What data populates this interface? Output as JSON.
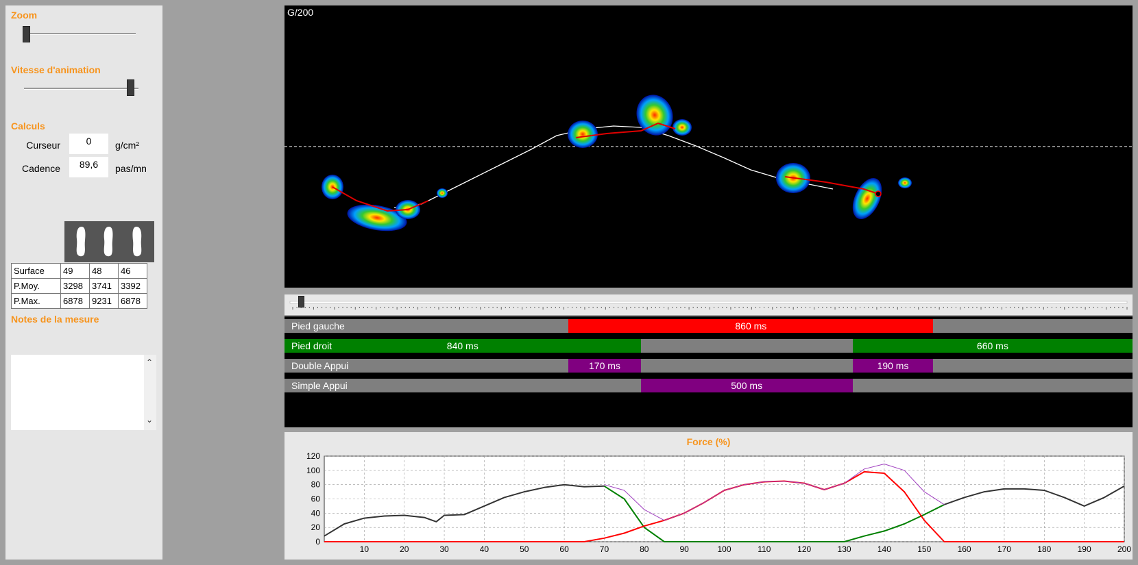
{
  "left": {
    "zoom_title": "Zoom",
    "zoom_level": 0.0,
    "speed_title": "Vitesse d'animation",
    "speed_level": 1.0,
    "calc_title": "Calculs",
    "cursor_label": "Curseur",
    "cursor_value": "0",
    "cursor_unit": "g/cm²",
    "cadence_label": "Cadence",
    "cadence_value": "89,6",
    "cadence_unit": "pas/mn",
    "feet_icons": [
      "left-foot-icon",
      "both-feet-icon",
      "right-foot-icon"
    ],
    "stats": [
      {
        "label": "Surface",
        "values": [
          "49",
          "48",
          "46"
        ]
      },
      {
        "label": "P.Moy.",
        "values": [
          "3298",
          "3741",
          "3392"
        ]
      },
      {
        "label": "P.Max.",
        "values": [
          "6878",
          "9231",
          "6878"
        ]
      }
    ],
    "notes_title": "Notes de la mesure",
    "notes_text": ""
  },
  "canvas": {
    "label": "G/200",
    "playhead_position": 0.01
  },
  "phases": [
    {
      "label": "Pied gauche",
      "segments": [
        {
          "start": 0.335,
          "end": 0.765,
          "color": "#ff0000",
          "text": "860 ms"
        }
      ]
    },
    {
      "label": "Pied droit",
      "segments": [
        {
          "start": 0.0,
          "end": 0.42,
          "color": "#008000",
          "text": "840 ms"
        },
        {
          "start": 0.67,
          "end": 1.0,
          "color": "#008000",
          "text": "660 ms"
        }
      ]
    },
    {
      "label": "Double Appui",
      "segments": [
        {
          "start": 0.335,
          "end": 0.42,
          "color": "#800080",
          "text": "170 ms"
        },
        {
          "start": 0.67,
          "end": 0.765,
          "color": "#800080",
          "text": "190 ms"
        }
      ]
    },
    {
      "label": "Simple Appui",
      "segments": [
        {
          "start": 0.42,
          "end": 0.67,
          "color": "#800080",
          "text": "500 ms"
        }
      ]
    }
  ],
  "chart_data": {
    "type": "line",
    "title": "Force (%)",
    "xlabel": "",
    "ylabel": "",
    "xlim": [
      0,
      200
    ],
    "ylim": [
      0,
      120
    ],
    "xticks": [
      10,
      20,
      30,
      40,
      50,
      60,
      70,
      80,
      90,
      100,
      110,
      120,
      130,
      140,
      150,
      160,
      170,
      180,
      190,
      200
    ],
    "yticks": [
      0,
      20,
      40,
      60,
      80,
      100,
      120
    ],
    "grid": true,
    "series": [
      {
        "color": "#333333",
        "x": [
          0,
          5,
          10,
          15,
          20,
          25,
          28,
          30,
          35,
          40,
          45,
          50,
          55,
          60,
          65,
          70,
          75,
          80,
          85,
          90,
          95,
          100,
          105,
          110,
          115,
          120,
          125,
          130,
          135,
          140,
          145,
          150,
          155,
          160,
          165,
          170,
          175,
          180,
          185,
          190,
          195,
          200
        ],
        "y": [
          8,
          25,
          33,
          36,
          37,
          34,
          28,
          37,
          38,
          50,
          62,
          70,
          76,
          80,
          77,
          78,
          null,
          null,
          null,
          null,
          null,
          null,
          null,
          null,
          null,
          null,
          null,
          null,
          null,
          null,
          null,
          null,
          52,
          62,
          70,
          74,
          74,
          72,
          62,
          50,
          62,
          78
        ]
      },
      {
        "color": "#008000",
        "x": [
          0,
          5,
          10,
          15,
          20,
          25,
          28,
          30,
          35,
          40,
          45,
          50,
          55,
          60,
          65,
          70,
          75,
          80,
          85,
          90,
          95,
          100,
          105,
          110,
          115,
          120,
          125,
          130,
          135,
          140,
          145,
          150,
          155,
          160,
          165,
          170,
          175,
          180,
          185,
          190,
          195,
          200
        ],
        "y": [
          null,
          null,
          null,
          null,
          null,
          null,
          null,
          null,
          null,
          null,
          null,
          null,
          null,
          null,
          null,
          78,
          60,
          20,
          0,
          0,
          0,
          0,
          0,
          0,
          0,
          0,
          0,
          0,
          8,
          15,
          25,
          38,
          52,
          null,
          null,
          null,
          null,
          null,
          null,
          null,
          null,
          null
        ]
      },
      {
        "color": "#ff0000",
        "x": [
          0,
          5,
          10,
          15,
          20,
          25,
          28,
          30,
          35,
          40,
          45,
          50,
          55,
          60,
          65,
          70,
          75,
          80,
          85,
          90,
          95,
          100,
          105,
          110,
          115,
          120,
          125,
          130,
          135,
          140,
          145,
          150,
          155,
          160,
          165,
          170,
          175,
          180,
          185,
          190,
          195,
          200
        ],
        "y": [
          0,
          0,
          0,
          0,
          0,
          0,
          0,
          0,
          0,
          0,
          0,
          0,
          0,
          0,
          0,
          5,
          12,
          22,
          30,
          40,
          55,
          72,
          80,
          84,
          85,
          82,
          73,
          82,
          98,
          96,
          70,
          30,
          0,
          0,
          0,
          0,
          0,
          0,
          0,
          0,
          0,
          0
        ]
      },
      {
        "color": "#a040c0",
        "x": [
          0,
          5,
          10,
          15,
          20,
          25,
          28,
          30,
          35,
          40,
          45,
          50,
          55,
          60,
          65,
          70,
          75,
          80,
          85,
          90,
          95,
          100,
          105,
          110,
          115,
          120,
          125,
          130,
          135,
          140,
          145,
          150,
          155,
          160,
          165,
          170,
          175,
          180,
          185,
          190,
          195,
          200
        ],
        "y": [
          null,
          null,
          null,
          null,
          null,
          null,
          null,
          null,
          null,
          null,
          null,
          null,
          null,
          null,
          null,
          80,
          72,
          45,
          30,
          40,
          55,
          72,
          80,
          84,
          85,
          82,
          73,
          82,
          102,
          109,
          100,
          70,
          52,
          null,
          null,
          null,
          null,
          null,
          null,
          null,
          null,
          null
        ]
      }
    ]
  }
}
